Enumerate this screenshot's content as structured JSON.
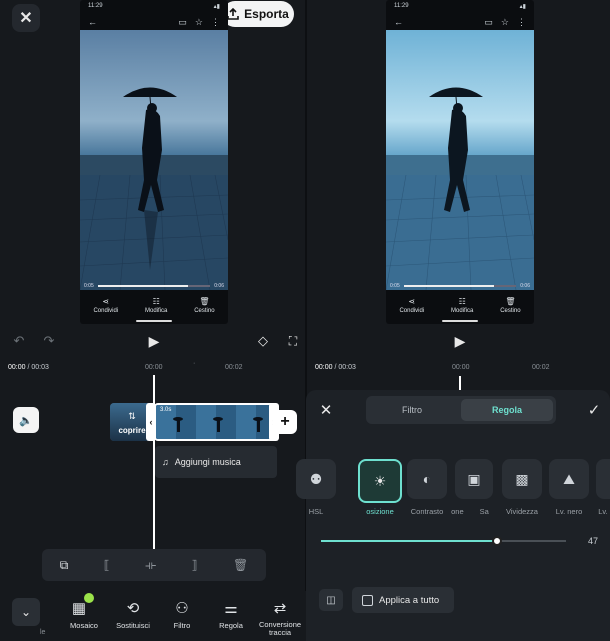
{
  "export_label": "Esporta",
  "close_icon_glyph": "✕",
  "phone": {
    "status_time": "11:29",
    "seek_start": "0:05",
    "seek_end": "0:06",
    "actions": [
      "Condividi",
      "Modifica",
      "Cestino"
    ],
    "action_icons": [
      "share-icon",
      "sliders-icon",
      "trash-icon"
    ]
  },
  "timeline": {
    "current_time": "00:00",
    "total_time": "/ 00:03",
    "ruler_marks": [
      "00:00",
      "00:02"
    ],
    "clip_duration": "3.0s",
    "cover_label": "coprire",
    "music_label": "Aggiungi musica"
  },
  "right_timeline": {
    "current_time": "00:00",
    "total_time": "/ 00:03",
    "ruler_marks": [
      "00:00",
      "00:02"
    ]
  },
  "toolbar": {
    "tools": [
      {
        "label": "Mosaico",
        "icon": "mosaic-icon"
      },
      {
        "label": "Sostituisci",
        "icon": "replace-icon"
      },
      {
        "label": "Filtro",
        "icon": "filter-icon"
      },
      {
        "label": "Regola",
        "icon": "adjust-icon"
      },
      {
        "label": "Conversione traccia",
        "icon": "track-conversion-icon"
      }
    ],
    "partial_label": "le"
  },
  "adjust_panel": {
    "tabs": [
      "Filtro",
      "Regola"
    ],
    "active_tab": "Regola",
    "items": [
      {
        "label": "HSL"
      },
      {
        "label": "osizione",
        "selected": true
      },
      {
        "label": "Contrasto"
      },
      {
        "label": "one"
      },
      {
        "label": "Sa"
      },
      {
        "label": "Vividezza"
      },
      {
        "label": "Lv. nero"
      },
      {
        "label": "Lv."
      }
    ],
    "slider_value": "47",
    "slider_fraction": 0.72,
    "apply_all_label": "Applica a tutto"
  },
  "colors": {
    "accent": "#6ee0cf",
    "background": "#16191d"
  }
}
